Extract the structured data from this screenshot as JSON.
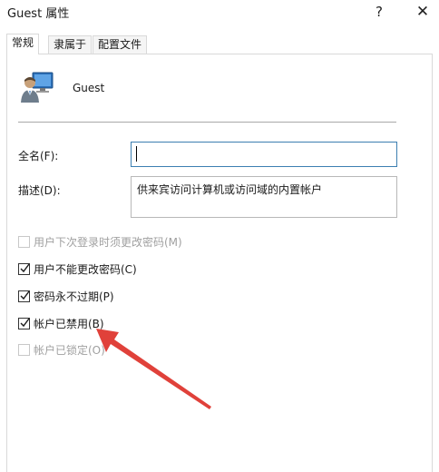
{
  "window": {
    "title": "Guest 属性",
    "help_label": "?",
    "close_label": "✕"
  },
  "tabs": [
    {
      "label": "常规",
      "active": true
    },
    {
      "label": "隶属于",
      "active": false
    },
    {
      "label": "配置文件",
      "active": false
    }
  ],
  "account": {
    "username": "Guest",
    "icon": "user-account-icon"
  },
  "fields": {
    "fullname_label": "全名(F):",
    "fullname_value": "",
    "description_label": "描述(D):",
    "description_value": "供来宾访问计算机或访问域的内置帐户"
  },
  "checkboxes": [
    {
      "label": "用户下次登录时须更改密码(M)",
      "checked": false,
      "enabled": false
    },
    {
      "label": "用户不能更改密码(C)",
      "checked": true,
      "enabled": true
    },
    {
      "label": "密码永不过期(P)",
      "checked": true,
      "enabled": true
    },
    {
      "label": "帐户已禁用(B)",
      "checked": true,
      "enabled": true
    },
    {
      "label": "帐户已锁定(O)",
      "checked": false,
      "enabled": false
    }
  ],
  "annotation": {
    "arrow_color": "#e0413a",
    "icon": "red-arrow-icon"
  }
}
